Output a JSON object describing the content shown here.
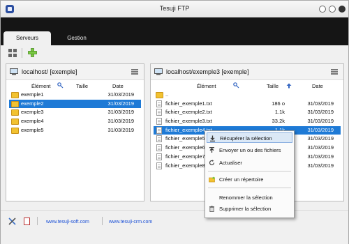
{
  "window": {
    "title": "Tesuji FTP"
  },
  "tabs": [
    {
      "label": "Serveurs"
    },
    {
      "label": "Gestion"
    }
  ],
  "left_panel": {
    "title": "localhost/ [exemple]",
    "columns": {
      "name": "Élément",
      "size": "Taille",
      "date": "Date"
    },
    "rows": [
      {
        "name": "exemple1",
        "size": "",
        "date": "31/03/2019",
        "type": "folder"
      },
      {
        "name": "exemple2",
        "size": "",
        "date": "31/03/2019",
        "type": "folder",
        "selected": true
      },
      {
        "name": "exemple3",
        "size": "",
        "date": "31/03/2019",
        "type": "folder"
      },
      {
        "name": "exemple4",
        "size": "",
        "date": "31/03/2019",
        "type": "folder"
      },
      {
        "name": "exemple5",
        "size": "",
        "date": "31/03/2019",
        "type": "folder"
      }
    ]
  },
  "right_panel": {
    "title": "localhost/exemple3 [exemple]",
    "columns": {
      "name": "Élément",
      "size": "Taille",
      "date": "Date"
    },
    "rows": [
      {
        "name": "..",
        "size": "",
        "date": "",
        "type": "folder"
      },
      {
        "name": "fichier_exemple1.txt",
        "size": "186 o",
        "date": "31/03/2019",
        "type": "file"
      },
      {
        "name": "fichier_exemple2.txt",
        "size": "1.1k",
        "date": "31/03/2019",
        "type": "file"
      },
      {
        "name": "fichier_exemple3.txt",
        "size": "33.2k",
        "date": "31/03/2019",
        "type": "file"
      },
      {
        "name": "fichier_exemple4.txt",
        "size": "1.1k",
        "date": "31/03/2019",
        "type": "file",
        "selected": true
      },
      {
        "name": "fichier_exemple5.txt",
        "size": "",
        "date": "31/03/2019",
        "type": "file"
      },
      {
        "name": "fichier_exemple6.txt",
        "size": "",
        "date": "31/03/2019",
        "type": "file"
      },
      {
        "name": "fichier_exemple7.txt",
        "size": "",
        "date": "31/03/2019",
        "type": "file"
      },
      {
        "name": "fichier_exemple8.txt",
        "size": "",
        "date": "31/03/2019",
        "type": "file"
      }
    ]
  },
  "context_menu": {
    "items": [
      {
        "label": "Récupérer la sélection",
        "icon": "download-icon",
        "highlighted": true
      },
      {
        "label": "Envoyer un ou des fichiers",
        "icon": "upload-icon"
      },
      {
        "label": "Actualiser",
        "icon": "refresh-icon"
      },
      {
        "label": "Créer un répertoire",
        "icon": "new-folder-icon"
      },
      {
        "label": "Renommer la sélection",
        "icon": ""
      },
      {
        "label": "Supprimer la sélection",
        "icon": "trash-icon"
      }
    ]
  },
  "statusbar": {
    "link1": "www.tesuji-soft.com",
    "link2": "www.tesuji-crm.com"
  },
  "colors": {
    "tabbar_bg": "#151515",
    "selection": "#1e7ad6",
    "link": "#1a4fd6",
    "folder": "#f2c230"
  }
}
